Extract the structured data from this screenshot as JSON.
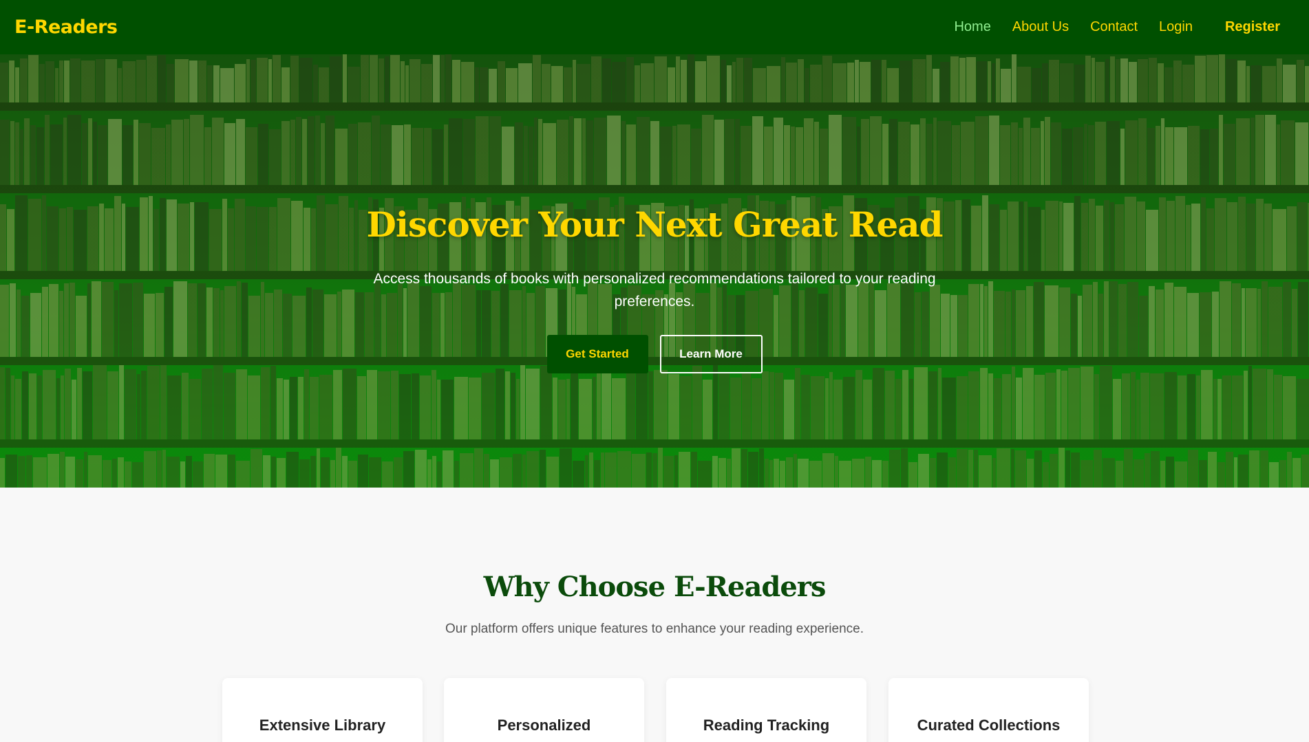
{
  "brand": "E-Readers",
  "nav": {
    "home": "Home",
    "about": "About Us",
    "contact": "Contact",
    "login": "Login",
    "register": "Register"
  },
  "hero": {
    "title": "Discover Your Next Great Read",
    "subtitle": "Access thousands of books with personalized recommendations tailored to your reading preferences.",
    "primary_button": "Get Started",
    "secondary_button": "Learn More"
  },
  "features": {
    "title": "Why Choose E-Readers",
    "subtitle": "Our platform offers unique features to enhance your reading experience.",
    "cards": [
      {
        "title": "Extensive Library"
      },
      {
        "title": "Personalized"
      },
      {
        "title": "Reading Tracking"
      },
      {
        "title": "Curated Collections"
      }
    ]
  },
  "colors": {
    "nav_bg": "#005000",
    "accent_gold": "#ffd700",
    "active_link": "#90ee90",
    "heading_green": "#0b4b0b"
  }
}
